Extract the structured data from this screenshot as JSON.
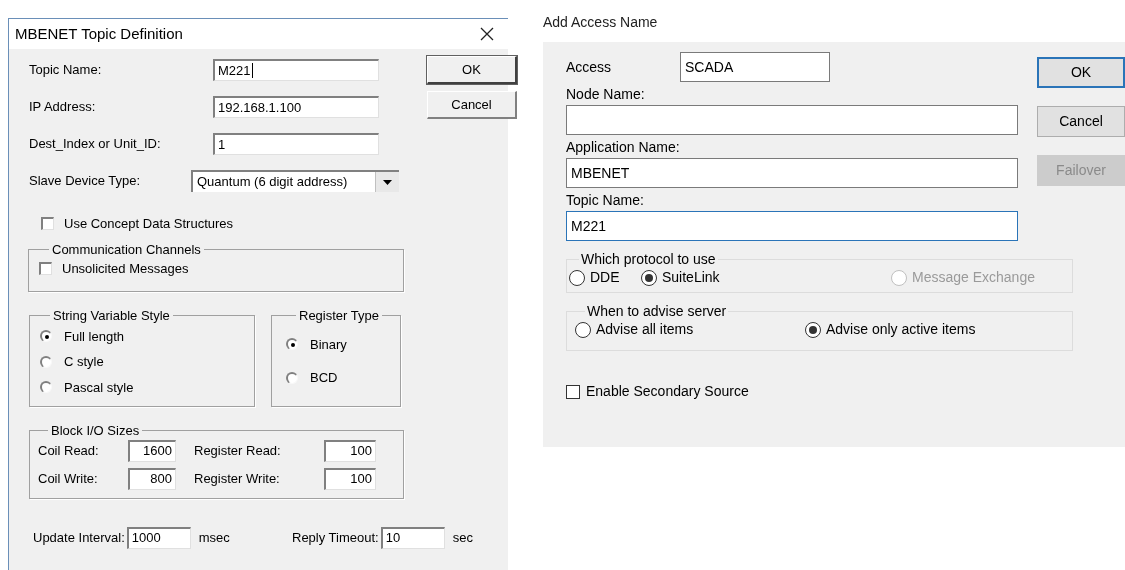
{
  "topic_dialog": {
    "title": "MBENET Topic Definition",
    "fields": [
      {
        "label": "Topic Name:",
        "value": "M221",
        "focused": true
      },
      {
        "label": "IP Address:",
        "value": "192.168.1.100",
        "focused": false
      },
      {
        "label": "Dest_Index or Unit_ID:",
        "value": "1",
        "focused": false
      }
    ],
    "slave_type": {
      "label": "Slave Device Type:",
      "value": "Quantum (6 digit address)"
    },
    "buttons": [
      {
        "label": "OK",
        "default": true
      },
      {
        "label": "Cancel",
        "default": false
      }
    ],
    "concept_checkbox": {
      "label": "Use Concept Data Structures",
      "checked": false
    },
    "channels": {
      "title": "Communication Channels",
      "checkbox": {
        "label": "Unsolicited Messages",
        "checked": false
      }
    },
    "string_style": {
      "title": "String Variable Style",
      "options": [
        {
          "label": "Full length",
          "selected": true
        },
        {
          "label": "C style",
          "selected": false
        },
        {
          "label": "Pascal style",
          "selected": false
        }
      ]
    },
    "register_type": {
      "title": "Register Type",
      "options": [
        {
          "label": "Binary",
          "selected": true
        },
        {
          "label": "BCD",
          "selected": false
        }
      ]
    },
    "block_io": {
      "title": "Block I/O Sizes",
      "items": [
        {
          "label": "Coil Read:",
          "value": "1600"
        },
        {
          "label": "Register Read:",
          "value": "100"
        },
        {
          "label": "Coil Write:",
          "value": "800"
        },
        {
          "label": "Register Write:",
          "value": "100"
        }
      ]
    },
    "timing": [
      {
        "label": "Update Interval:",
        "value": "1000",
        "unit": "msec"
      },
      {
        "label": "Reply Timeout:",
        "value": "10",
        "unit": "sec"
      }
    ]
  },
  "access_dialog": {
    "title": "Add Access Name",
    "access": {
      "label": "Access",
      "value": "SCADA"
    },
    "fields": [
      {
        "label": "Node Name:",
        "focused": false
      },
      {
        "label": "Application Name:",
        "value": "MBENET",
        "focused": false
      },
      {
        "label": "Topic Name:",
        "value": "M221",
        "focused": true
      }
    ],
    "buttons": [
      {
        "label": "OK",
        "default": true,
        "disabled": false
      },
      {
        "label": "Cancel",
        "default": false,
        "disabled": false
      },
      {
        "label": "Failover",
        "default": false,
        "disabled": true
      }
    ],
    "protocol": {
      "title": "Which protocol to use",
      "options": [
        {
          "label": "DDE",
          "selected": false,
          "disabled": false
        },
        {
          "label": "SuiteLink",
          "selected": true,
          "disabled": false
        },
        {
          "label": "Message Exchange",
          "selected": false,
          "disabled": true
        }
      ]
    },
    "advise": {
      "title": "When to advise server",
      "options": [
        {
          "label": "Advise all items",
          "selected": false,
          "disabled": false
        },
        {
          "label": "Advise only active items",
          "selected": true,
          "disabled": false
        }
      ]
    },
    "secondary_checkbox": {
      "label": "Enable Secondary Source",
      "checked": false
    }
  }
}
